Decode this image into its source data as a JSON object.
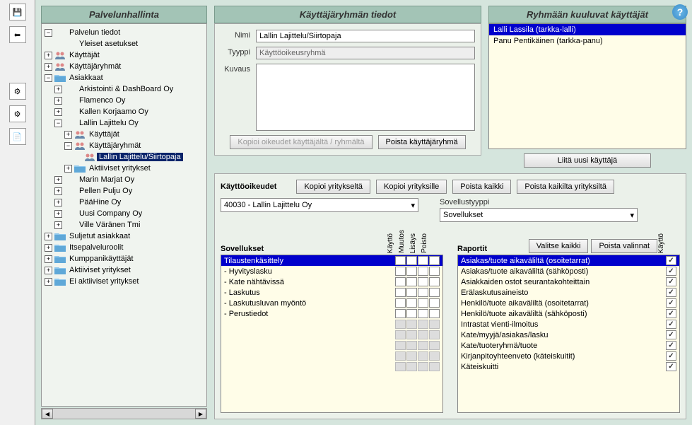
{
  "leftPanel": {
    "title": "Palvelunhallinta"
  },
  "tree": [
    {
      "lvl": 0,
      "exp": "-",
      "icon": "node",
      "label": "Palvelun tiedot"
    },
    {
      "lvl": 1,
      "exp": "",
      "icon": "node",
      "label": "Yleiset asetukset"
    },
    {
      "lvl": 0,
      "exp": "+",
      "icon": "people",
      "label": "Käyttäjät"
    },
    {
      "lvl": 0,
      "exp": "+",
      "icon": "people",
      "label": "Käyttäjäryhmät"
    },
    {
      "lvl": 0,
      "exp": "-",
      "icon": "folder",
      "label": "Asiakkaat"
    },
    {
      "lvl": 1,
      "exp": "+",
      "icon": "node",
      "label": "Arkistointi & DashBoard Oy"
    },
    {
      "lvl": 1,
      "exp": "+",
      "icon": "node",
      "label": "Flamenco Oy"
    },
    {
      "lvl": 1,
      "exp": "+",
      "icon": "node",
      "label": "Kallen Korjaamo Oy"
    },
    {
      "lvl": 1,
      "exp": "-",
      "icon": "node",
      "label": "Lallin Lajittelu Oy"
    },
    {
      "lvl": 2,
      "exp": "+",
      "icon": "people",
      "label": "Käyttäjät"
    },
    {
      "lvl": 2,
      "exp": "-",
      "icon": "people",
      "label": "Käyttäjäryhmät"
    },
    {
      "lvl": 3,
      "exp": "",
      "icon": "people",
      "label": "Lallin Lajittelu/Siirtopaja",
      "selected": true
    },
    {
      "lvl": 2,
      "exp": "+",
      "icon": "folder",
      "label": "Aktiiviset yritykset"
    },
    {
      "lvl": 1,
      "exp": "+",
      "icon": "node",
      "label": "Marin Marjat Oy"
    },
    {
      "lvl": 1,
      "exp": "+",
      "icon": "node",
      "label": "Pellen Pulju Oy"
    },
    {
      "lvl": 1,
      "exp": "+",
      "icon": "node",
      "label": "PääHine Oy"
    },
    {
      "lvl": 1,
      "exp": "+",
      "icon": "node",
      "label": "Uusi Company Oy"
    },
    {
      "lvl": 1,
      "exp": "+",
      "icon": "node",
      "label": "Ville Väränen Tmi"
    },
    {
      "lvl": 0,
      "exp": "+",
      "icon": "folder",
      "label": "Suljetut asiakkaat"
    },
    {
      "lvl": 0,
      "exp": "+",
      "icon": "folder",
      "label": "Itsepalveluroolit"
    },
    {
      "lvl": 0,
      "exp": "+",
      "icon": "folder",
      "label": "Kumppanikäyttäjät"
    },
    {
      "lvl": 0,
      "exp": "+",
      "icon": "folder",
      "label": "Aktiiviset yritykset"
    },
    {
      "lvl": 0,
      "exp": "+",
      "icon": "folder",
      "label": "Ei aktiiviset yritykset"
    }
  ],
  "details": {
    "title": "Käyttäjäryhmän tiedot",
    "labels": {
      "nimi": "Nimi",
      "tyyppi": "Tyyppi",
      "kuvaus": "Kuvaus"
    },
    "values": {
      "nimi": "Lallin Lajittelu/Siirtopaja",
      "tyyppi": "Käyttöoikeusryhmä",
      "kuvaus": ""
    },
    "buttons": {
      "copy": "Kopioi oikeudet käyttäjältä / ryhmältä",
      "delete": "Poista käyttäjäryhmä"
    }
  },
  "users": {
    "title": "Ryhmään kuuluvat käyttäjät",
    "items": [
      {
        "label": "Lalli Lassila (tarkka-lalli)",
        "selected": true
      },
      {
        "label": "Panu Pentikäinen (tarkka-panu)",
        "selected": false
      }
    ],
    "addBtn": "Liitä uusi käyttäjä"
  },
  "perms": {
    "title": "Käyttöoikeudet",
    "buttons": {
      "copyFrom": "Kopioi yritykseltä",
      "copyTo": "Kopioi yrityksille",
      "removeAll": "Poista kaikki",
      "removeAllCompanies": "Poista kaikilta yrityksiltä"
    },
    "companySelect": "40030 - Lallin Lajittelu Oy",
    "appTypeLabel": "Sovellustyyppi",
    "appTypeSelect": "Sovellukset",
    "appsCol": {
      "title": "Sovellukset",
      "headers": [
        "Käyttö",
        "Muutos",
        "Lisäys",
        "Poisto"
      ],
      "rows": [
        {
          "name": "Tilaustenkäsittely",
          "selected": true,
          "chk": [
            false,
            false,
            false,
            false
          ]
        },
        {
          "name": "- Hyvityslasku",
          "chk": [
            false,
            false,
            false,
            false
          ]
        },
        {
          "name": "- Kate nähtävissä",
          "chk": [
            false,
            false,
            false,
            false
          ]
        },
        {
          "name": "- Laskutus",
          "chk": [
            false,
            false,
            false,
            false
          ]
        },
        {
          "name": "- Laskutusluvan myöntö",
          "chk": [
            false,
            false,
            false,
            false
          ]
        },
        {
          "name": "- Perustiedot",
          "chk": [
            false,
            false,
            false,
            false
          ]
        },
        {
          "name": "",
          "chk": [
            null,
            null,
            null,
            null
          ]
        },
        {
          "name": "",
          "chk": [
            null,
            null,
            null,
            null
          ]
        },
        {
          "name": "",
          "chk": [
            null,
            null,
            null,
            null
          ]
        },
        {
          "name": "",
          "chk": [
            null,
            null,
            null,
            null
          ]
        },
        {
          "name": "",
          "chk": [
            null,
            null,
            null,
            null
          ]
        }
      ]
    },
    "reportsCol": {
      "title": "Raportit",
      "buttons": {
        "selectAll": "Valitse kaikki",
        "removeSel": "Poista valinnat"
      },
      "header": "Käyttö",
      "rows": [
        {
          "name": "Asiakas/tuote aikaväliltä (osoitetarrat)",
          "selected": true,
          "chk": true
        },
        {
          "name": "Asiakas/tuote aikaväliltä (sähköposti)",
          "chk": true
        },
        {
          "name": "Asiakkaiden ostot seurantakohteittain",
          "chk": true
        },
        {
          "name": "Erälaskutusaineisto",
          "chk": true
        },
        {
          "name": "Henkilö/tuote aikaväliltä (osoitetarrat)",
          "chk": true
        },
        {
          "name": "Henkilö/tuote aikaväliltä (sähköposti)",
          "chk": true
        },
        {
          "name": "Intrastat vienti-ilmoitus",
          "chk": true
        },
        {
          "name": "Kate/myyjä/asiakas/lasku",
          "chk": true
        },
        {
          "name": "Kate/tuoteryhmä/tuote",
          "chk": true
        },
        {
          "name": "Kirjanpitoyhteenveto (käteiskuitit)",
          "chk": true
        },
        {
          "name": "Käteiskuitti",
          "chk": true
        }
      ]
    }
  }
}
